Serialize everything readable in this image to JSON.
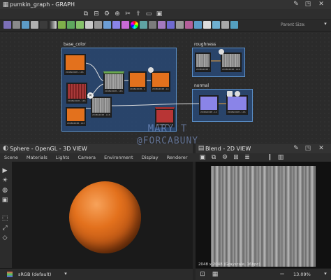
{
  "graph_panel": {
    "title": "pumkin_graph - GRAPH",
    "parent_size_label": "Parent Size:",
    "frames": {
      "base_color": "base_color",
      "roughness": "roughness",
      "normal": "normal"
    },
    "node_label": "2048x2048 - L16"
  },
  "view3d": {
    "title": "Sphere - OpenGL - 3D VIEW",
    "menu": [
      "Scene",
      "Materials",
      "Lights",
      "Camera",
      "Environment",
      "Display",
      "Renderer"
    ],
    "colorspace": "sRGB (default)"
  },
  "view2d": {
    "title": "Blend - 2D VIEW",
    "info": "2048 x 2048 (Grayscale, 16bpc)",
    "zoom": "13.09%"
  },
  "watermark": {
    "line1": "MARY T",
    "line2": "@FORCABUNY"
  },
  "colors": {
    "accent_blue": "#5a8fc8",
    "pumpkin_orange": "#e3711d",
    "normal_purple": "#8a84e8",
    "frame_fill": "#2a4e80"
  },
  "toolbar_icons": [
    "graph-new-icon",
    "bitmap-icon",
    "vector-icon",
    "pixel-processor-icon",
    "fx-map-icon",
    "gradient-icon",
    "blend-icon",
    "levels-icon",
    "curve-icon",
    "uniform-color-icon",
    "transform-icon",
    "text-icon",
    "normal-icon",
    "output-icon",
    "input-icon",
    "function-icon",
    "value-icon"
  ]
}
